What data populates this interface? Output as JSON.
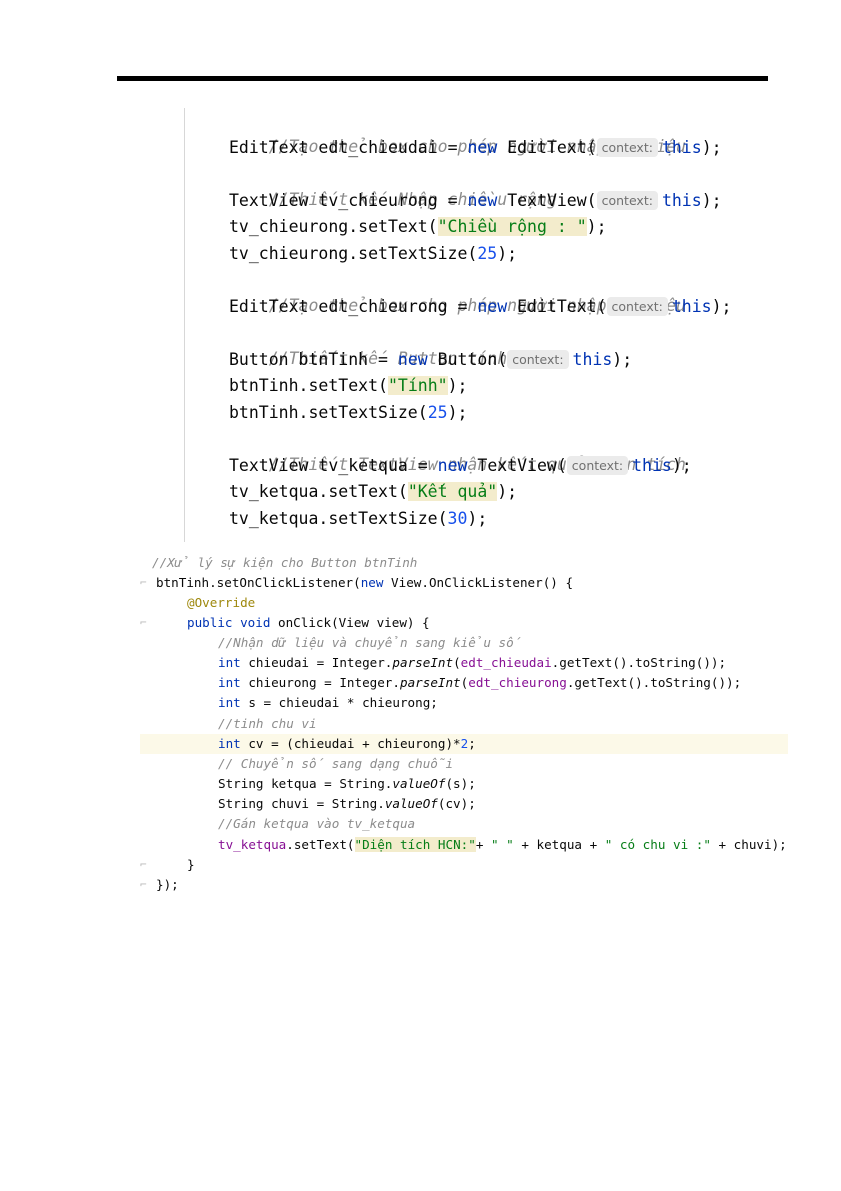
{
  "code_block_1": {
    "hint_label": "context:",
    "lines": [
      {
        "comment": "//Tạo thẻ box cho phép người nhập dữ liệu"
      },
      {
        "type": "EditText",
        "var": "edt_chieudai",
        "eq": " = ",
        "new": "new",
        "ctor": "EditText(",
        "arg": "this",
        "tail": ");"
      },
      {
        "comment": "//Thiết kế Nhập chiều rộng"
      },
      {
        "type": "TextView",
        "var": "tv_chieurong",
        "eq": " = ",
        "new": "new",
        "ctor": "TextView(",
        "arg": "this",
        "tail": ");"
      },
      {
        "call": "tv_chieurong.setText(",
        "str": "\"Chiều rộng : \"",
        "tail": ");"
      },
      {
        "call": "tv_chieurong.setTextSize(",
        "num": "25",
        "tail": ");"
      },
      {
        "comment": "//Tạo thẻ box cho phép người nhập dữ liệu"
      },
      {
        "type": "EditText",
        "var": "edt_chieurong",
        "eq": " = ",
        "new": "new",
        "ctor": "EditText(",
        "arg": "this",
        "tail": ");"
      },
      {
        "comment": "//Thiết kế Button tính"
      },
      {
        "type": "Button",
        "var": "btnTinh",
        "eq": " = ",
        "new": "new",
        "ctor": "Button(",
        "arg": "this",
        "tail": ");"
      },
      {
        "call": "btnTinh.setText(",
        "str": "\"Tính\"",
        "tail": ");"
      },
      {
        "call": "btnTinh.setTextSize(",
        "num": "25",
        "tail": ");"
      },
      {
        "comment": "//Thiết TextView nhận kết quả diện tích"
      },
      {
        "type": "TextView",
        "var": "tv_ketqua",
        "eq": " = ",
        "new": "new",
        "ctor": "TextView(",
        "arg": "this",
        "tail": ");"
      },
      {
        "call": "tv_ketqua.setText(",
        "str": "\"Kết quả\"",
        "tail": ");"
      },
      {
        "call": "tv_ketqua.setTextSize(",
        "num": "30",
        "tail": ");"
      }
    ]
  },
  "code_block_2": {
    "l0": "//Xử lý sự kiện cho Button btnTinh",
    "l1a": "btnTinh.setOnClickListener(",
    "l1b": "new",
    "l1c": " View.OnClickListener() {",
    "l2": "@Override",
    "l3a": "public void ",
    "l3b": "onClick(View view) {",
    "l4": "//Nhận dữ liệu và chuyển sang kiểu số",
    "l5a": "int",
    "l5b": " chieudai = Integer.",
    "l5c": "parseInt",
    "l5d": "(",
    "l5e": "edt_chieudai",
    "l5f": ".getText().toString());",
    "l6a": "int",
    "l6b": " chieurong = Integer.",
    "l6c": "parseInt",
    "l6d": "(",
    "l6e": "edt_chieurong",
    "l6f": ".getText().toString());",
    "l7a": "int",
    "l7b": " s = chieudai * chieurong;",
    "l8": "//tinh chu vi",
    "l9a": "int",
    "l9b": " cv = (chieudai + chieurong)*",
    "l9c": "2",
    "l9d": ";",
    "l10": "// Chuyển số sang dạng chuỗi",
    "l11a": "String ketqua = String.",
    "l11b": "valueOf",
    "l11c": "(s);",
    "l12a": "String chuvi = String.",
    "l12b": "valueOf",
    "l12c": "(cv);",
    "l13": "//Gán ketqua vào tv_ketqua",
    "l14a": "tv_ketqua",
    "l14b": ".setText(",
    "l14c": "\"Diện tích HCN:\"",
    "l14d": "+ ",
    "l14e": "\" \"",
    "l14f": " + ketqua + ",
    "l14g": "\" có chu vi :\"",
    "l14h": " + chuvi);",
    "l15": "}",
    "l16": "});"
  }
}
